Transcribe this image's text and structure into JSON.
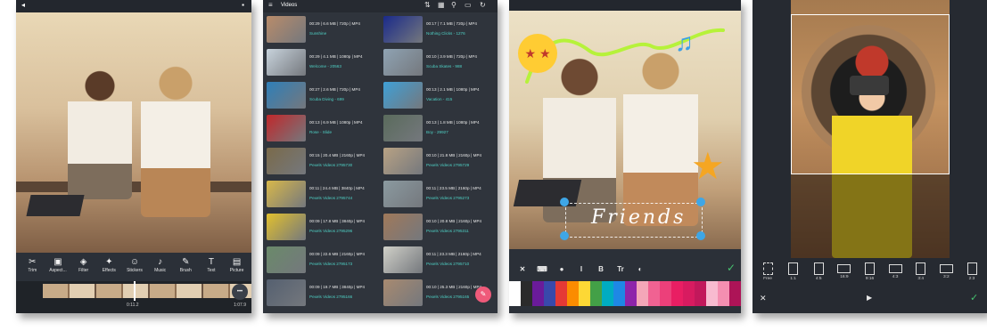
{
  "screen1": {
    "tools": [
      {
        "icon": "scissors-icon",
        "glyph": "✂",
        "label": "Trim"
      },
      {
        "icon": "aspect-icon",
        "glyph": "▣",
        "label": "Aspect..."
      },
      {
        "icon": "filter-icon",
        "glyph": "◈",
        "label": "Filter"
      },
      {
        "icon": "effects-icon",
        "glyph": "✦",
        "label": "Effects"
      },
      {
        "icon": "stickers-icon",
        "glyph": "☺",
        "label": "Stickers"
      },
      {
        "icon": "music-icon",
        "glyph": "♪",
        "label": "Music"
      },
      {
        "icon": "brush-icon",
        "glyph": "✎",
        "label": "Brush"
      },
      {
        "icon": "text-icon",
        "glyph": "T",
        "label": "Text"
      },
      {
        "icon": "picture-icon",
        "glyph": "▤",
        "label": "Picture"
      }
    ],
    "time_left": "0:11.2",
    "time_right": "1:07.9",
    "more_glyph": "•••"
  },
  "screen2": {
    "title": "Videos",
    "videos": [
      {
        "meta": "00:29 | 6.6 MB | 720p | MP4",
        "name": "Sunshine"
      },
      {
        "meta": "00:17 | 7.1 MB | 720p | MP4",
        "name": "Nothing Clicks - 1276"
      },
      {
        "meta": "00:29 | 4.1 MB | 1080p | MP4",
        "name": "Welcome - 20563"
      },
      {
        "meta": "00:10 | 3.9 MB | 720p | MP4",
        "name": "Scuba Skates - 988"
      },
      {
        "meta": "00:27 | 2.6 MB | 720p | MP4",
        "name": "Scuba Diving - 699"
      },
      {
        "meta": "00:13 | 2.1 MB | 1080p | MP4",
        "name": "Vacation - 415"
      },
      {
        "meta": "00:13 | 6.9 MB | 1080p | MP4",
        "name": "Rose - Slide"
      },
      {
        "meta": "00:13 | 1.8 MB | 1080p | MP4",
        "name": "Boy - 29927"
      },
      {
        "meta": "00:15 | 20.4 MB | 2160p | MP4",
        "name": "Pexels Videos 2795730"
      },
      {
        "meta": "00:10 | 21.8 MB | 2160p | MP4",
        "name": "Pexels Videos 2795729"
      },
      {
        "meta": "00:11 | 24.4 MB | 3840p | MP4",
        "name": "Pexels Videos 2795744"
      },
      {
        "meta": "00:11 | 23.5 MB | 2160p | MP4",
        "name": "Pexels Videos 2795273"
      },
      {
        "meta": "00:09 | 17.8 MB | 3840p | MP4",
        "name": "Pexels Videos 2795296"
      },
      {
        "meta": "00:10 | 20.8 MB | 2160p | MP4",
        "name": "Pexels Videos 2795311"
      },
      {
        "meta": "00:09 | 22.6 MB | 2160p | MP4",
        "name": "Pexels Videos 2795173"
      },
      {
        "meta": "00:11 | 23.3 MB | 2160p | MP4",
        "name": "Pexels Videos 2795710"
      },
      {
        "meta": "00:09 | 19.7 MB | 3840p | MP4",
        "name": "Pexels Videos 2795166"
      },
      {
        "meta": "00:10 | 25.3 MB | 2160p | MP4",
        "name": "Pexels Videos 2795165"
      }
    ]
  },
  "screen3": {
    "friends_text": "Friends",
    "text_tools": [
      {
        "icon": "close-icon",
        "glyph": "✕"
      },
      {
        "icon": "keyboard-icon",
        "glyph": "⌨"
      },
      {
        "icon": "palette-icon",
        "glyph": "●"
      },
      {
        "icon": "italic-icon",
        "glyph": "I"
      },
      {
        "icon": "bold-icon",
        "glyph": "B"
      },
      {
        "icon": "font-icon",
        "glyph": "Tr"
      },
      {
        "icon": "opacity-icon",
        "glyph": "◐"
      }
    ],
    "palette": [
      "#ffffff",
      "#2b2b2b",
      "#6a1b9a",
      "#3949ab",
      "#e53935",
      "#fb8c00",
      "#fdd835",
      "#43a047",
      "#00acc1",
      "#1e88e5",
      "#8e24aa",
      "#f4a6b8",
      "#f06292",
      "#ec407a",
      "#e91e63",
      "#d81b60",
      "#c2185b",
      "#f8bbd0",
      "#f48fb1",
      "#ad1457"
    ]
  },
  "screen4": {
    "ratios": [
      {
        "label": "Free",
        "icon": "crop-free-icon"
      },
      {
        "label": "1:1",
        "icon": "ratio-1-1-icon"
      },
      {
        "label": "4:5",
        "icon": "ratio-4-5-icon"
      },
      {
        "label": "16:9",
        "icon": "ratio-16-9-icon"
      },
      {
        "label": "9:16",
        "icon": "ratio-9-16-icon"
      },
      {
        "label": "4:3",
        "icon": "ratio-4-3-icon"
      },
      {
        "label": "3:4",
        "icon": "ratio-3-4-icon"
      },
      {
        "label": "3:2",
        "icon": "ratio-3-2-icon"
      },
      {
        "label": "2:3",
        "icon": "ratio-2-3-icon"
      }
    ]
  },
  "colors": {
    "toolbar": "#2b3038",
    "accent": "#4fd1c5",
    "confirm": "#46c26f",
    "fab": "#ef5a7a"
  }
}
